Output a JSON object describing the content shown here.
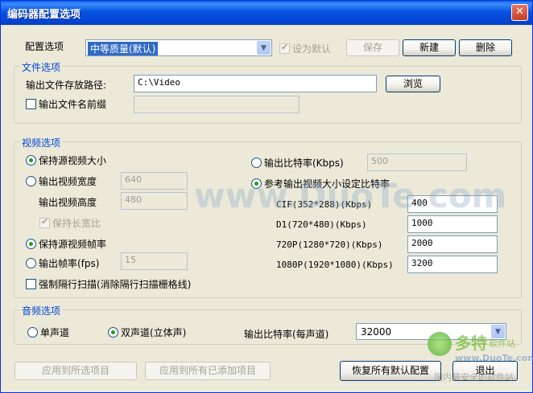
{
  "window": {
    "title": "编码器配置选项",
    "close_symbol": "✕"
  },
  "config": {
    "label": "配置选项",
    "preset_selected": "中等质量(默认)",
    "set_default_label": "设为默认",
    "set_default_checked": true,
    "save_label": "保存",
    "new_label": "新建",
    "delete_label": "删除"
  },
  "file_options": {
    "group_title": "文件选项",
    "path_label": "输出文件存放路径:",
    "path_value": "C:\\Video",
    "browse_label": "浏览",
    "prefix_label": "输出文件名前缀",
    "prefix_checked": false,
    "prefix_value": ""
  },
  "video_options": {
    "group_title": "视频选项",
    "keep_size_label": "保持源视频大小",
    "keep_size_selected": true,
    "width_label": "输出视频宽度",
    "width_value": "640",
    "height_label": "输出视频高度",
    "height_value": "480",
    "keep_ratio_label": "保持长宽比",
    "keep_ratio_checked": true,
    "keep_fps_label": "保持源视频帧率",
    "keep_fps_selected": true,
    "fps_label": "输出帧率(fps)",
    "fps_value": "15",
    "deinterlace_label": "强制隔行扫描(消除隔行扫描栅格线)",
    "deinterlace_checked": false,
    "bitrate_label": "输出比特率(Kbps)",
    "bitrate_value": "500",
    "ref_bitrate_label": "参考输出视频大小设定比特率",
    "ref_bitrate_selected": true,
    "cif_label": "CIF(352*288)(Kbps)",
    "cif_value": "400",
    "d1_label": "D1(720*480)(Kbps)",
    "d1_value": "1000",
    "p720_label": "720P(1280*720)(Kbps)",
    "p720_value": "2000",
    "p1080_label": "1080P(1920*1080)(Kbps)",
    "p1080_value": "3200"
  },
  "audio_options": {
    "group_title": "音频选项",
    "mono_label": "单声道",
    "stereo_label": "双声道(立体声)",
    "stereo_selected": true,
    "bitrate_label": "输出比特率(每声道)",
    "bitrate_selected": "32000"
  },
  "footer": {
    "apply_selected_label": "应用到所选项目",
    "apply_all_label": "应用到所有已添加项目",
    "restore_defaults_label": "恢复所有默认配置",
    "exit_label": "退出"
  },
  "watermark": {
    "center_text": "www.DuoTe.com",
    "logo_title": "多特",
    "logo_subtitle": "软件站",
    "logo_url": "www.DuoTe.com",
    "logo_tagline": "国内最安全的软件站"
  },
  "colors": {
    "title_bar": "#0754E3",
    "group_title": "#0046D5",
    "window_bg": "#ECE9D8",
    "check_mark": "#21A121"
  }
}
